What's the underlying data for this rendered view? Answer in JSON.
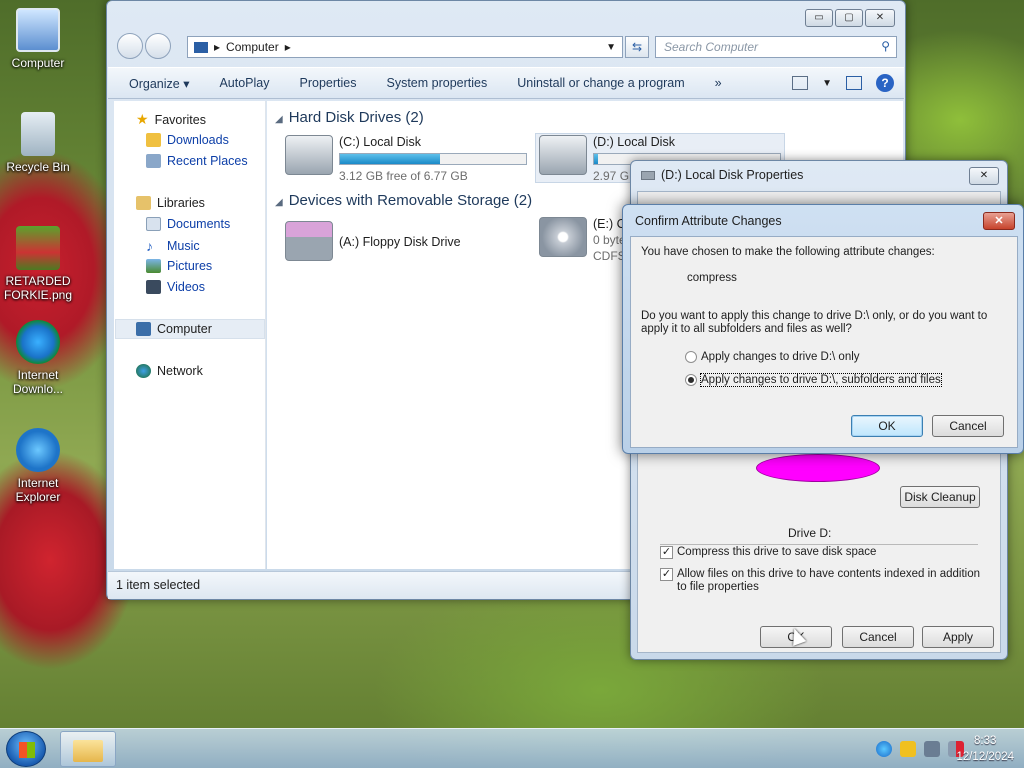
{
  "desktop": {
    "icons": [
      {
        "label": "Computer",
        "icon": "computer-icon"
      },
      {
        "label": "Recycle Bin",
        "icon": "recycle-bin-icon"
      },
      {
        "label": "RETARDED FORKIE.png",
        "icon": "image-file-icon"
      },
      {
        "label": "Internet Downlo...",
        "icon": "internet-download-manager-icon"
      },
      {
        "label": "Internet Explorer",
        "icon": "internet-explorer-icon"
      }
    ]
  },
  "explorer": {
    "window_buttons": {
      "minimize": "▭",
      "maximize": "▢",
      "close": "✕"
    },
    "address": {
      "path": "Computer",
      "separator": "▸"
    },
    "search": {
      "placeholder": "Search Computer"
    },
    "toolbar": {
      "items": [
        "Organize ▾",
        "AutoPlay",
        "Properties",
        "System properties",
        "Uninstall or change a program",
        "»"
      ]
    },
    "nav": {
      "favorites": "Favorites",
      "downloads": "Downloads",
      "recent_places": "Recent Places",
      "libraries": "Libraries",
      "documents": "Documents",
      "music": "Music",
      "pictures": "Pictures",
      "videos": "Videos",
      "computer": "Computer",
      "network": "Network"
    },
    "groups": {
      "hard_disks": "Hard Disk Drives (2)",
      "removable": "Devices with Removable Storage (2)"
    },
    "drives": {
      "c": {
        "name": "(C:) Local Disk",
        "free": "3.12 GB free of 6.77 GB",
        "used_fraction": 0.54
      },
      "d": {
        "name": "(D:) Local Disk",
        "free": "2.97 GB",
        "used_fraction": 0.02
      },
      "a": {
        "name": "(A:) Floppy Disk Drive"
      },
      "e": {
        "name": "(E:) Cl",
        "line2": "0 byte",
        "line3": "CDFS"
      }
    },
    "status": "1 item selected"
  },
  "properties": {
    "title": "(D:) Local Disk Properties",
    "drive_label": "Drive D:",
    "disk_cleanup": "Disk Cleanup",
    "compress": {
      "label": "Compress this drive to save disk space",
      "checked": true
    },
    "index": {
      "label": "Allow files on this drive to have contents indexed in addition to file properties",
      "checked": true
    },
    "buttons": {
      "ok": "OK",
      "cancel": "Cancel",
      "apply": "Apply"
    },
    "pie_color": "#ff00ff"
  },
  "confirm": {
    "title": "Confirm Attribute Changes",
    "intro": "You have chosen to make the following attribute changes:",
    "attribute": "compress",
    "question": "Do you want to apply this change to drive D:\\ only, or do you want to apply it to all subfolders and files as well?",
    "option_only": "Apply changes to drive D:\\ only",
    "option_all": "Apply changes to drive D:\\, subfolders and files",
    "selected": "all",
    "ok": "OK",
    "cancel": "Cancel"
  },
  "taskbar": {
    "time": "8:33",
    "date": "12/12/2024"
  }
}
